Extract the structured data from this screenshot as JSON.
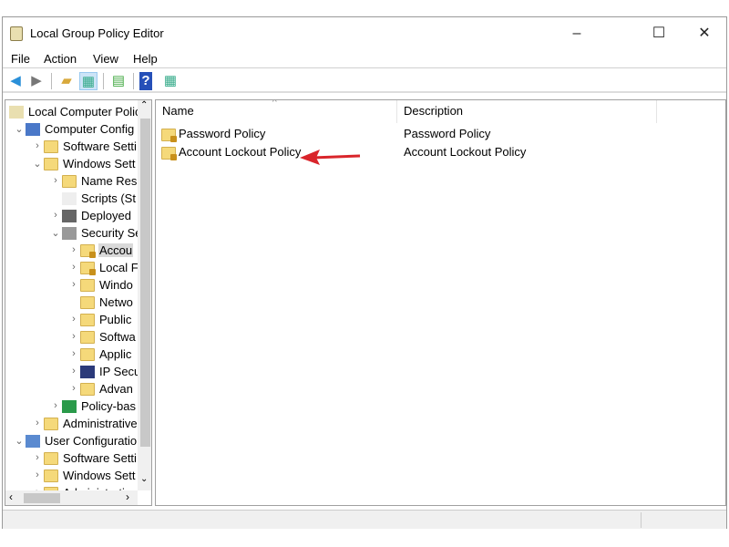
{
  "window": {
    "title": "Local Group Policy Editor",
    "minimize": "–",
    "maximize": "☐",
    "close": "✕"
  },
  "menu": [
    "File",
    "Action",
    "View",
    "Help"
  ],
  "toolbar": [
    {
      "icon": "back-arrow-icon"
    },
    {
      "icon": "forward-arrow-icon"
    },
    {
      "icon": "up-folder-icon"
    },
    {
      "icon": "show-hide-console-tree-icon",
      "active": true
    },
    {
      "icon": "export-list-icon"
    },
    {
      "icon": "help-icon"
    },
    {
      "icon": "show-action-pane-icon"
    }
  ],
  "tree": [
    {
      "label": "Local Computer Polic",
      "level": 0,
      "chev": "",
      "icon": "policy-scroll"
    },
    {
      "label": "Computer Config",
      "level": 1,
      "chev": "down",
      "icon": "computer"
    },
    {
      "label": "Software Setti",
      "level": 2,
      "chev": "right",
      "icon": "folder"
    },
    {
      "label": "Windows Sett",
      "level": 2,
      "chev": "down",
      "icon": "folder"
    },
    {
      "label": "Name Res",
      "level": 3,
      "chev": "right",
      "icon": "folder"
    },
    {
      "label": "Scripts (St",
      "level": 3,
      "chev": "",
      "icon": "script"
    },
    {
      "label": "Deployed",
      "level": 3,
      "chev": "right",
      "icon": "printer"
    },
    {
      "label": "Security Se",
      "level": 3,
      "chev": "down",
      "icon": "security"
    },
    {
      "label": "Accou",
      "level": 4,
      "chev": "right",
      "icon": "lock-folder",
      "selected": true
    },
    {
      "label": "Local F",
      "level": 4,
      "chev": "right",
      "icon": "lock-folder"
    },
    {
      "label": "Windo",
      "level": 4,
      "chev": "right",
      "icon": "folder"
    },
    {
      "label": "Netwo",
      "level": 4,
      "chev": "",
      "icon": "folder"
    },
    {
      "label": "Public",
      "level": 4,
      "chev": "right",
      "icon": "folder"
    },
    {
      "label": "Softwa",
      "level": 4,
      "chev": "right",
      "icon": "folder"
    },
    {
      "label": "Applic",
      "level": 4,
      "chev": "right",
      "icon": "folder"
    },
    {
      "label": "IP Secu",
      "level": 4,
      "chev": "right",
      "icon": "ip-security"
    },
    {
      "label": "Advan",
      "level": 4,
      "chev": "right",
      "icon": "folder"
    },
    {
      "label": "Policy-bas",
      "level": 3,
      "chev": "right",
      "icon": "chart"
    },
    {
      "label": "Administrative",
      "level": 2,
      "chev": "right",
      "icon": "folder"
    },
    {
      "label": "User Configuratio",
      "level": 1,
      "chev": "down",
      "icon": "user"
    },
    {
      "label": "Software Setti",
      "level": 2,
      "chev": "right",
      "icon": "folder"
    },
    {
      "label": "Windows Sett",
      "level": 2,
      "chev": "right",
      "icon": "folder"
    },
    {
      "label": "Administrative",
      "level": 2,
      "chev": "right",
      "icon": "folder"
    }
  ],
  "list": {
    "columns": [
      "Name",
      "Description"
    ],
    "sort_indicator": "^",
    "rows": [
      {
        "name": "Password Policy",
        "description": "Password Policy"
      },
      {
        "name": "Account Lockout Policy",
        "description": "Account Lockout Policy"
      }
    ]
  },
  "annotation": {
    "type": "red-arrow",
    "color": "#d9252b",
    "target": "Account Lockout Policy"
  }
}
